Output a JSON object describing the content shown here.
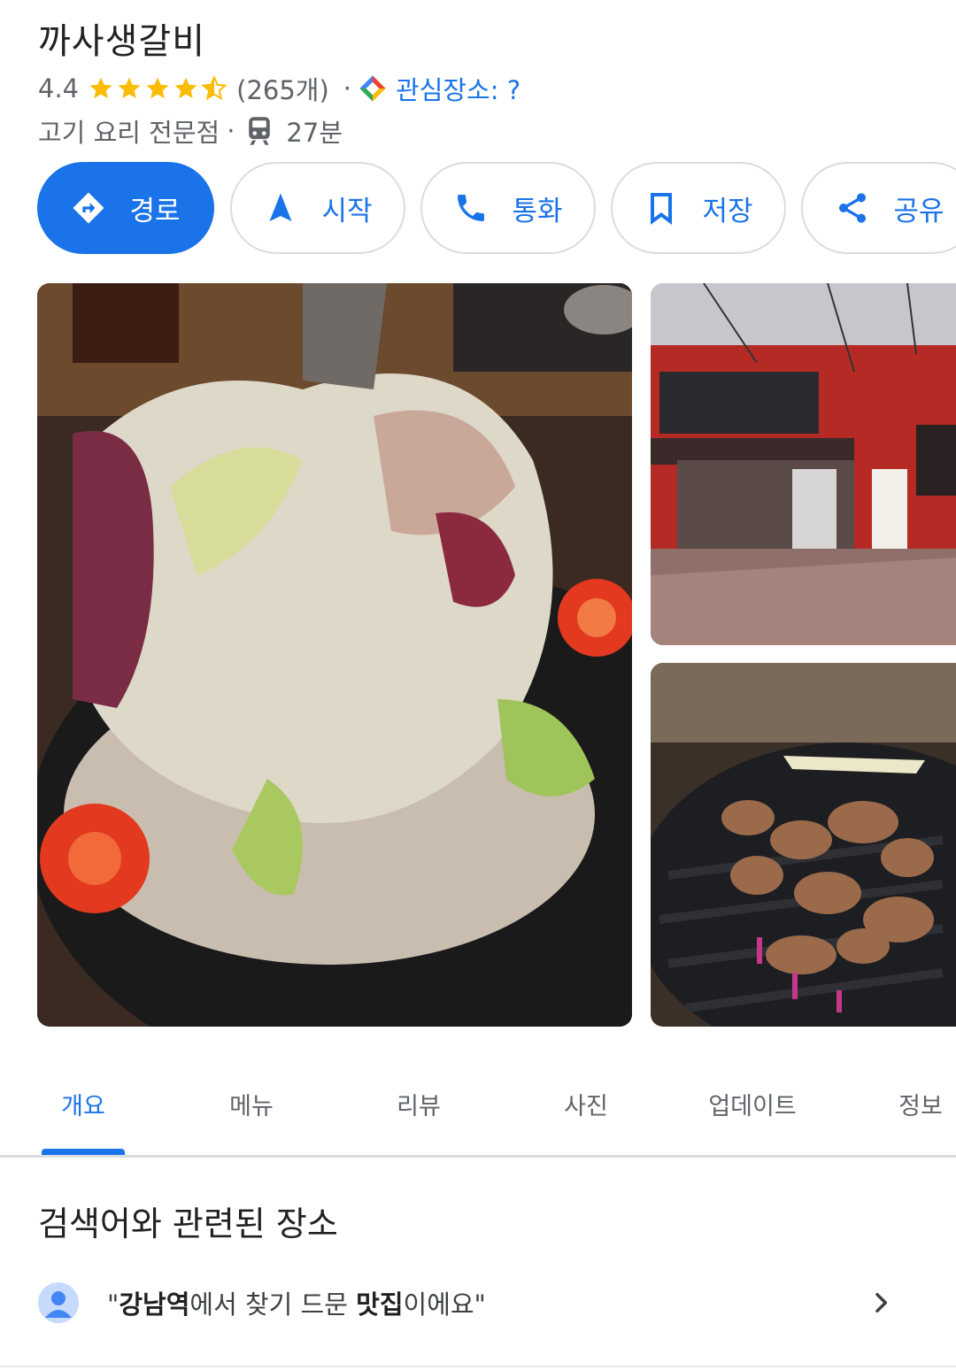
{
  "place": {
    "name": "까사생갈비",
    "rating": "4.4",
    "review_count": "(265개)",
    "rating_stars_value": 4.4,
    "separator": "·",
    "interest_label": "관심장소: ?",
    "category": "고기 요리 전문점",
    "transit_time": "27분"
  },
  "actions": {
    "directions": "경로",
    "start": "시작",
    "call": "통화",
    "save": "저장",
    "share": "공유"
  },
  "photos": {
    "main": "salad-dish-photo",
    "storefront": "restaurant-storefront-photo",
    "grill": "grilled-meat-photo"
  },
  "tabs": {
    "overview": "개요",
    "menu": "메뉴",
    "reviews": "리뷰",
    "photos": "사진",
    "updates": "업데이트",
    "info": "정보"
  },
  "related": {
    "title": "검색어와 관련된 장소",
    "quote_open": "\"",
    "quote_part1": "강남역",
    "quote_part2": "에서 찾기 드문 ",
    "quote_part3": "맛집",
    "quote_part4": "이에요\""
  },
  "colors": {
    "accent": "#1a73e8",
    "star": "#fbbc04",
    "text_secondary": "#5f6368"
  }
}
